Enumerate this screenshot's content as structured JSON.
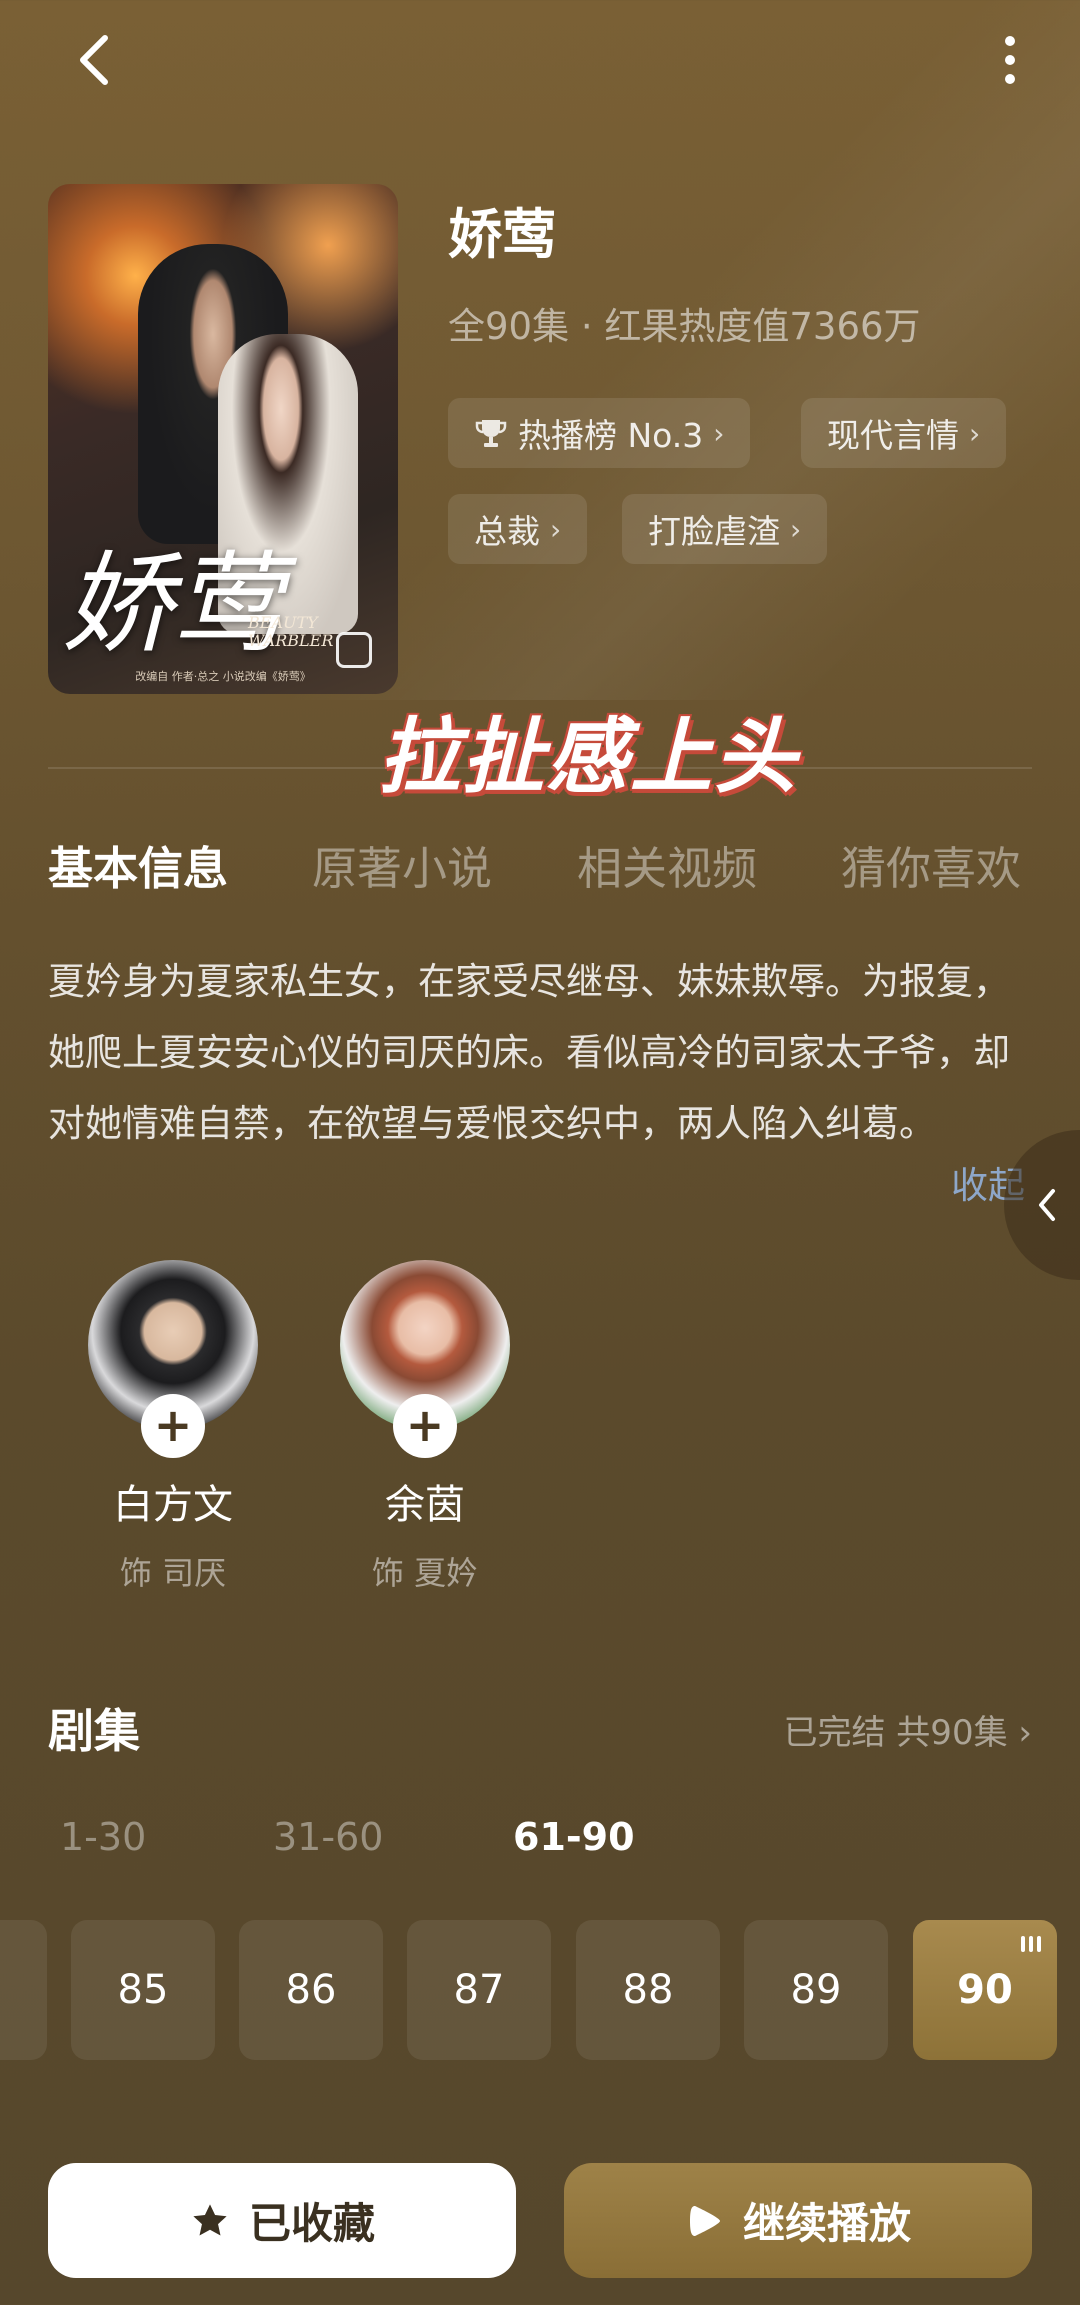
{
  "header": {
    "back_icon": "chevron-left-icon",
    "more_icon": "more-vertical-icon"
  },
  "drama": {
    "poster": {
      "title_art": "娇莺",
      "subtitle_art": "BEAUTY WARBLER",
      "credit": "改编自 作者·总之 小说改编《娇莺》"
    },
    "title": "娇莺",
    "meta": "全90集 · 红果热度值7366万",
    "tags": [
      {
        "label": "热播榜 No.3",
        "icon": "trophy-icon"
      },
      {
        "label": "现代言情"
      },
      {
        "label": "总裁"
      },
      {
        "label": "打脸虐渣"
      }
    ]
  },
  "overlay_caption": "拉扯感上头",
  "tabs": [
    "基本信息",
    "原著小说",
    "相关视频",
    "猜你喜欢"
  ],
  "active_tab": "基本信息",
  "synopsis": "夏妗身为夏家私生女，在家受尽继母、妹妹欺辱。为报复，她爬上夏安安心仪的司厌的床。看似高冷的司家太子爷，却对她情难自禁，在欲望与爱恨交织中，两人陷入纠葛。",
  "collapse_label": "收起",
  "cast": [
    {
      "name": "白方文",
      "role": "饰 司厌"
    },
    {
      "name": "余茵",
      "role": "饰 夏妗"
    }
  ],
  "episodes": {
    "title": "剧集",
    "status": "已完结 共90集",
    "ranges": [
      "1-30",
      "31-60",
      "61-90"
    ],
    "active_range": "61-90",
    "items": [
      "85",
      "86",
      "87",
      "88",
      "89",
      "90"
    ],
    "current": "90"
  },
  "actions": {
    "favorite_label": "已收藏",
    "play_label": "继续播放"
  },
  "colors": {
    "accent_gold": "#9e8248",
    "link_blue": "#8ea7c9",
    "caption_outline": "#c64a3a"
  }
}
